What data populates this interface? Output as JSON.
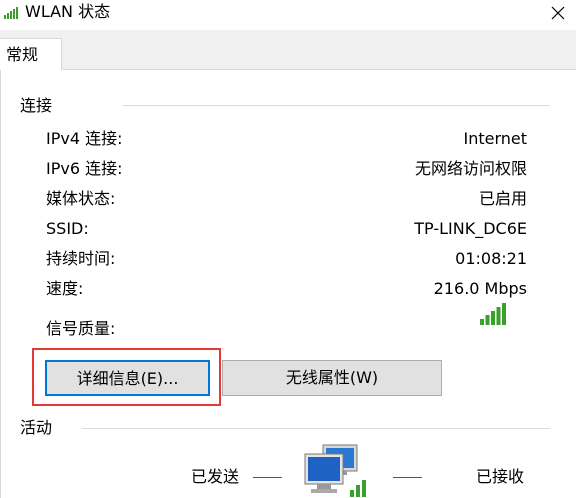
{
  "window": {
    "title": "WLAN 状态",
    "close_symbol": "✕"
  },
  "tabs": [
    {
      "label": "常规"
    }
  ],
  "connection": {
    "heading": "连接",
    "rows": [
      {
        "label": "IPv4 连接:",
        "value": "Internet"
      },
      {
        "label": "IPv6 连接:",
        "value": "无网络访问权限"
      },
      {
        "label": "媒体状态:",
        "value": "已启用"
      },
      {
        "label": "SSID:",
        "value": "TP-LINK_DC6E"
      },
      {
        "label": "持续时间:",
        "value": "01:08:21"
      },
      {
        "label": "速度:",
        "value": "216.0 Mbps"
      }
    ],
    "signal_label": "信号质量:",
    "signal_bars": 5,
    "signal_bars_total": 5,
    "signal_color": "#39a02b"
  },
  "buttons": {
    "details": "详细信息(E)...",
    "wireless_properties": "无线属性(W)"
  },
  "activity": {
    "heading": "活动",
    "sent_label": "已发送",
    "received_label": "已接收"
  },
  "colors": {
    "focus_border": "#0078d7",
    "highlight_box": "#e53935",
    "button_face": "#e1e1e1"
  },
  "icons": {
    "title": "signal-bars-icon",
    "activity": "network-computers-icon"
  }
}
